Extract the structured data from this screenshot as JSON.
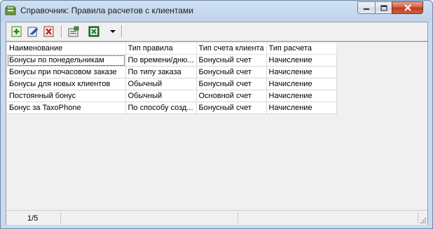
{
  "window": {
    "title": "Справочник: Правила расчетов с клиентами"
  },
  "toolbar": {
    "items": [
      "add-icon",
      "edit-icon",
      "delete-icon",
      "properties-icon",
      "excel-export-icon",
      "dropdown-arrow-icon"
    ]
  },
  "table": {
    "columns": [
      "Наименование",
      "Тип правила",
      "Тип счета клиента",
      "Тип расчета"
    ],
    "rows": [
      [
        "Бонусы по понедельникам",
        "По времени/дню...",
        "Бонусный счет",
        "Начисление"
      ],
      [
        "Бонусы при почасовом заказе",
        "По типу заказа",
        "Бонусный счет",
        "Начисление"
      ],
      [
        "Бонусы для новых клиентов",
        "Обычный",
        "Бонусный счет",
        "Начисление"
      ],
      [
        "Постоянный бонус",
        "Обычный",
        "Основной счет",
        "Начисление"
      ],
      [
        "Бонус за TaxoPhone",
        "По способу созд...",
        "Бонусный счет",
        "Начисление"
      ]
    ]
  },
  "status": {
    "position": "1/5"
  }
}
